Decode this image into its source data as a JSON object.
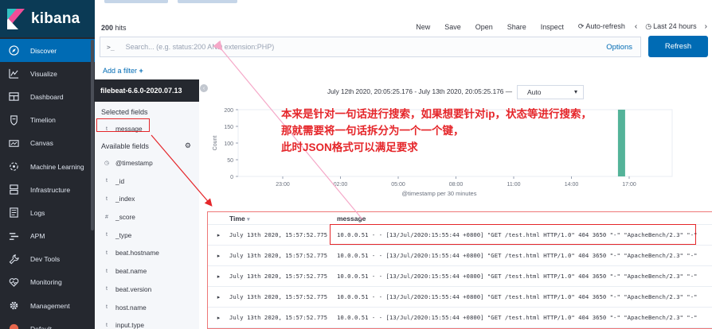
{
  "app": {
    "name": "kibana"
  },
  "nav": [
    {
      "label": "Discover",
      "icon": "compass-icon",
      "active": true
    },
    {
      "label": "Visualize",
      "icon": "chart-icon"
    },
    {
      "label": "Dashboard",
      "icon": "dashboard-icon"
    },
    {
      "label": "Timelion",
      "icon": "shield-icon"
    },
    {
      "label": "Canvas",
      "icon": "canvas-icon"
    },
    {
      "label": "Machine Learning",
      "icon": "ml-icon"
    },
    {
      "label": "Infrastructure",
      "icon": "infrastructure-icon"
    },
    {
      "label": "Logs",
      "icon": "logs-icon"
    },
    {
      "label": "APM",
      "icon": "apm-icon"
    },
    {
      "label": "Dev Tools",
      "icon": "wrench-icon"
    },
    {
      "label": "Monitoring",
      "icon": "heartbeat-icon"
    },
    {
      "label": "Management",
      "icon": "gear-icon"
    },
    {
      "label": "Default",
      "icon": "avatar-icon"
    }
  ],
  "toolbar": {
    "hits_count": "200",
    "hits_label": "hits",
    "new": "New",
    "save": "Save",
    "open": "Open",
    "share": "Share",
    "inspect": "Inspect",
    "auto_refresh": "Auto-refresh",
    "time_range": "Last 24 hours"
  },
  "query": {
    "prefix": ">_",
    "placeholder": "Search... (e.g. status:200 AND extension:PHP)",
    "options": "Options",
    "refresh": "Refresh"
  },
  "filter": {
    "add": "Add a filter"
  },
  "fields": {
    "index_pattern": "filebeat-6.6.0-2020.07.13",
    "selected_heading": "Selected fields",
    "available_heading": "Available fields",
    "selected": [
      {
        "type": "t",
        "name": "message"
      }
    ],
    "available": [
      {
        "type": "clock",
        "name": "@timestamp"
      },
      {
        "type": "t",
        "name": "_id"
      },
      {
        "type": "t",
        "name": "_index"
      },
      {
        "type": "#",
        "name": "_score"
      },
      {
        "type": "t",
        "name": "_type"
      },
      {
        "type": "t",
        "name": "beat.hostname"
      },
      {
        "type": "t",
        "name": "beat.name"
      },
      {
        "type": "t",
        "name": "beat.version"
      },
      {
        "type": "t",
        "name": "host.name"
      },
      {
        "type": "t",
        "name": "input.type"
      }
    ]
  },
  "histogram": {
    "time_range_text": "July 12th 2020, 20:05:25.176 - July 13th 2020, 20:05:25.176 —",
    "interval": "Auto",
    "ylabel": "Count",
    "xlabel": "@timestamp per 30 minutes",
    "y_ticks": [
      "200",
      "150",
      "100",
      "50",
      "0"
    ],
    "x_ticks": [
      "23:00",
      "02:00",
      "05:00",
      "08:00",
      "11:00",
      "14:00",
      "17:00"
    ],
    "bar_color": "#54b399",
    "spike_value": 200,
    "spike_label_after": "16:30"
  },
  "table": {
    "columns": {
      "time": "Time",
      "message": "message"
    },
    "rows": [
      {
        "time": "July 13th 2020, 15:57:52.775",
        "message": "10.0.0.51 - - [13/Jul/2020:15:55:44 +0800] \"GET /test.html HTTP/1.0\" 404 3650 \"-\" \"ApacheBench/2.3\" \"-\""
      },
      {
        "time": "July 13th 2020, 15:57:52.775",
        "message": "10.0.0.51 - - [13/Jul/2020:15:55:44 +0800] \"GET /test.html HTTP/1.0\" 404 3650 \"-\" \"ApacheBench/2.3\" \"-\""
      },
      {
        "time": "July 13th 2020, 15:57:52.775",
        "message": "10.0.0.51 - - [13/Jul/2020:15:55:44 +0800] \"GET /test.html HTTP/1.0\" 404 3650 \"-\" \"ApacheBench/2.3\" \"-\""
      },
      {
        "time": "July 13th 2020, 15:57:52.775",
        "message": "10.0.0.51 - - [13/Jul/2020:15:55:44 +0800] \"GET /test.html HTTP/1.0\" 404 3650 \"-\" \"ApacheBench/2.3\" \"-\""
      },
      {
        "time": "July 13th 2020, 15:57:52.775",
        "message": "10.0.0.51 - - [13/Jul/2020:15:55:44 +0800] \"GET /test.html HTTP/1.0\" 404 3650 \"-\" \"ApacheBench/2.3\" \"-\""
      }
    ]
  },
  "annotation": {
    "lines": [
      "本来是针对一句话进行搜索，如果想要针对ip，状态等进行搜索，",
      "那就需要将一句话拆分为一个一个键，",
      "此时JSON格式可以满足要求"
    ],
    "color": "#e5262a"
  }
}
